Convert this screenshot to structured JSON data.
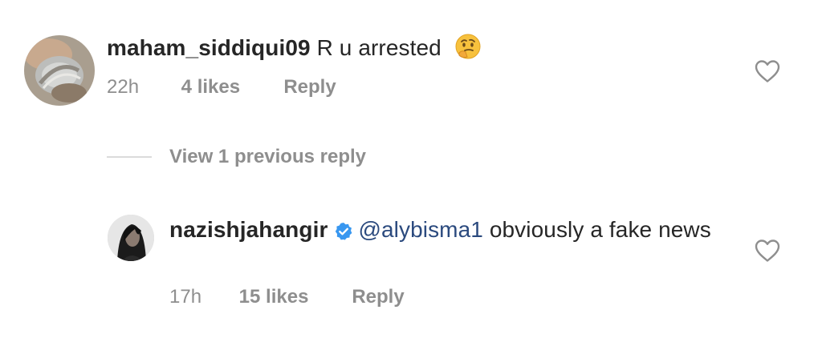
{
  "comment": {
    "username": "maham_siddiqui09",
    "text": "R u arrested",
    "emoji": "thinking-face-emoji",
    "time": "22h",
    "likes": "4 likes",
    "reply_label": "Reply",
    "avatar": "jewelry-ring-avatar"
  },
  "view_replies": {
    "label": "View 1 previous reply"
  },
  "reply": {
    "username": "nazishjahangir",
    "verified": true,
    "mention": "@alybisma1",
    "text": "obviously a fake news",
    "time": "17h",
    "likes": "15 likes",
    "reply_label": "Reply",
    "avatar": "dark-portrait-avatar"
  },
  "icons": {
    "like": "heart-outline-icon",
    "verified": "verified-badge-icon"
  },
  "colors": {
    "text": "#262626",
    "muted": "#8e8e8e",
    "mention": "#2b4a7e",
    "verified": "#3897f0",
    "divider": "#dbdbdb"
  }
}
